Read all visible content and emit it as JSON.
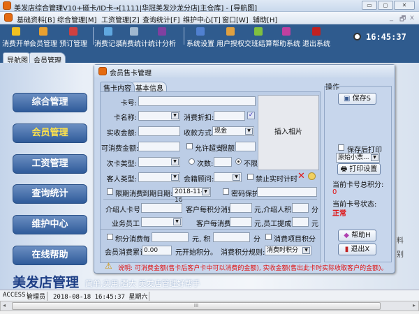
{
  "window": {
    "title": "美发店综合管理V10+磁卡/ID卡→[1111|华冠美发沙龙分店|主仓库] - [导航图]",
    "min": "▭",
    "max": "◻",
    "close": "✕"
  },
  "menu": [
    "基础资料[B]",
    "综合管理[M]",
    "工资管理[Z]",
    "查询统计[F]",
    "维护中心[T]",
    "窗口[W]",
    "辅助[H]"
  ],
  "mdi_controls": [
    "_",
    "🗗",
    "x"
  ],
  "toolbar": [
    "消费开单",
    "会员管理",
    "预订管理",
    "消费记录",
    "消费统计",
    "统计分析",
    "系统设置",
    "用户授权",
    "交班结算",
    "帮助系统",
    "退出系统"
  ],
  "clock": "16:45:37",
  "tabs": [
    "导航图",
    "会员管理"
  ],
  "sidebar": [
    "综合管理",
    "会员管理",
    "工资管理",
    "查询统计",
    "维护中心",
    "在线帮助"
  ],
  "footer": {
    "logo": "美发店管理",
    "slogan": "简单,实用,强大  美发店管理好帮手"
  },
  "background_fragments": [
    "料",
    "别"
  ],
  "dialog": {
    "title": "会员售卡管理",
    "tabs": [
      "售卡内容",
      "基本信息"
    ],
    "labels": {
      "card_no": "卡号:",
      "card_name": "卡名称:",
      "discount": "消费折扣:",
      "received": "实收金额:",
      "pay_method": "收款方式:",
      "spendable": "可消费金额:",
      "overdraft": "允许超支",
      "limit": "限额",
      "count_type": "次卡类型:",
      "count": "次数:",
      "unlimited": "不限",
      "guest_type": "客人类型:",
      "advisor": "会籍顾问:",
      "no_timing": "禁止实时计时",
      "photo": "插入相片",
      "limited": "限期消费",
      "expire": "到期日期:",
      "password": "密码保护",
      "intro_card": "介绍人卡号",
      "cust_per_point": "客户每积分消费",
      "yuan_intro": "元,介绍人积",
      "fen": "分",
      "staff": "业务员工",
      "cust_per_spend": "客户每消费",
      "yuan_staff": "元,员工提成",
      "yuan": "元",
      "points": "积分消费",
      "each": "每",
      "yuan_ji": "元, 积",
      "fen2": "分",
      "item_points": "消费项目积分",
      "accum": "会员消费累计",
      "start_points": "元开始积分。",
      "rule": "消费积分规则:"
    },
    "values": {
      "card_no": "",
      "card_name": "",
      "discount": "",
      "received": "",
      "pay_method": "现金",
      "spendable": "",
      "limit": "",
      "count_type": "",
      "count": "",
      "guest_type": "",
      "advisor": "",
      "expire": "2018-11-16",
      "password": "",
      "intro_card": "",
      "cust_per_point": "",
      "intro_points": "",
      "staff": "",
      "cust_per_spend": "",
      "staff_comm": "",
      "each_yuan": "",
      "each_points": "",
      "accum": "0.00",
      "rule": "消费时积分"
    },
    "notice": "说明: 可消费金额(售卡后客户卡中可以消费的金额), 实收金额(售出此卡时实际收取客户的金额)。",
    "ops": {
      "title": "操作",
      "save": "保存S",
      "print_after": "保存后打印",
      "print_tpl": "原始小票...",
      "print_setup": "打印设置",
      "total_points_label": "当前卡号总积分:",
      "total_points": "0",
      "status_label": "当前卡号状态:",
      "status": "正常",
      "help": "帮助H",
      "exit": "退出X"
    }
  },
  "statusbar": [
    "ACCESS",
    "管理员",
    "2018-08-18 16:45:37 星期六"
  ],
  "scroll_grip": "III"
}
